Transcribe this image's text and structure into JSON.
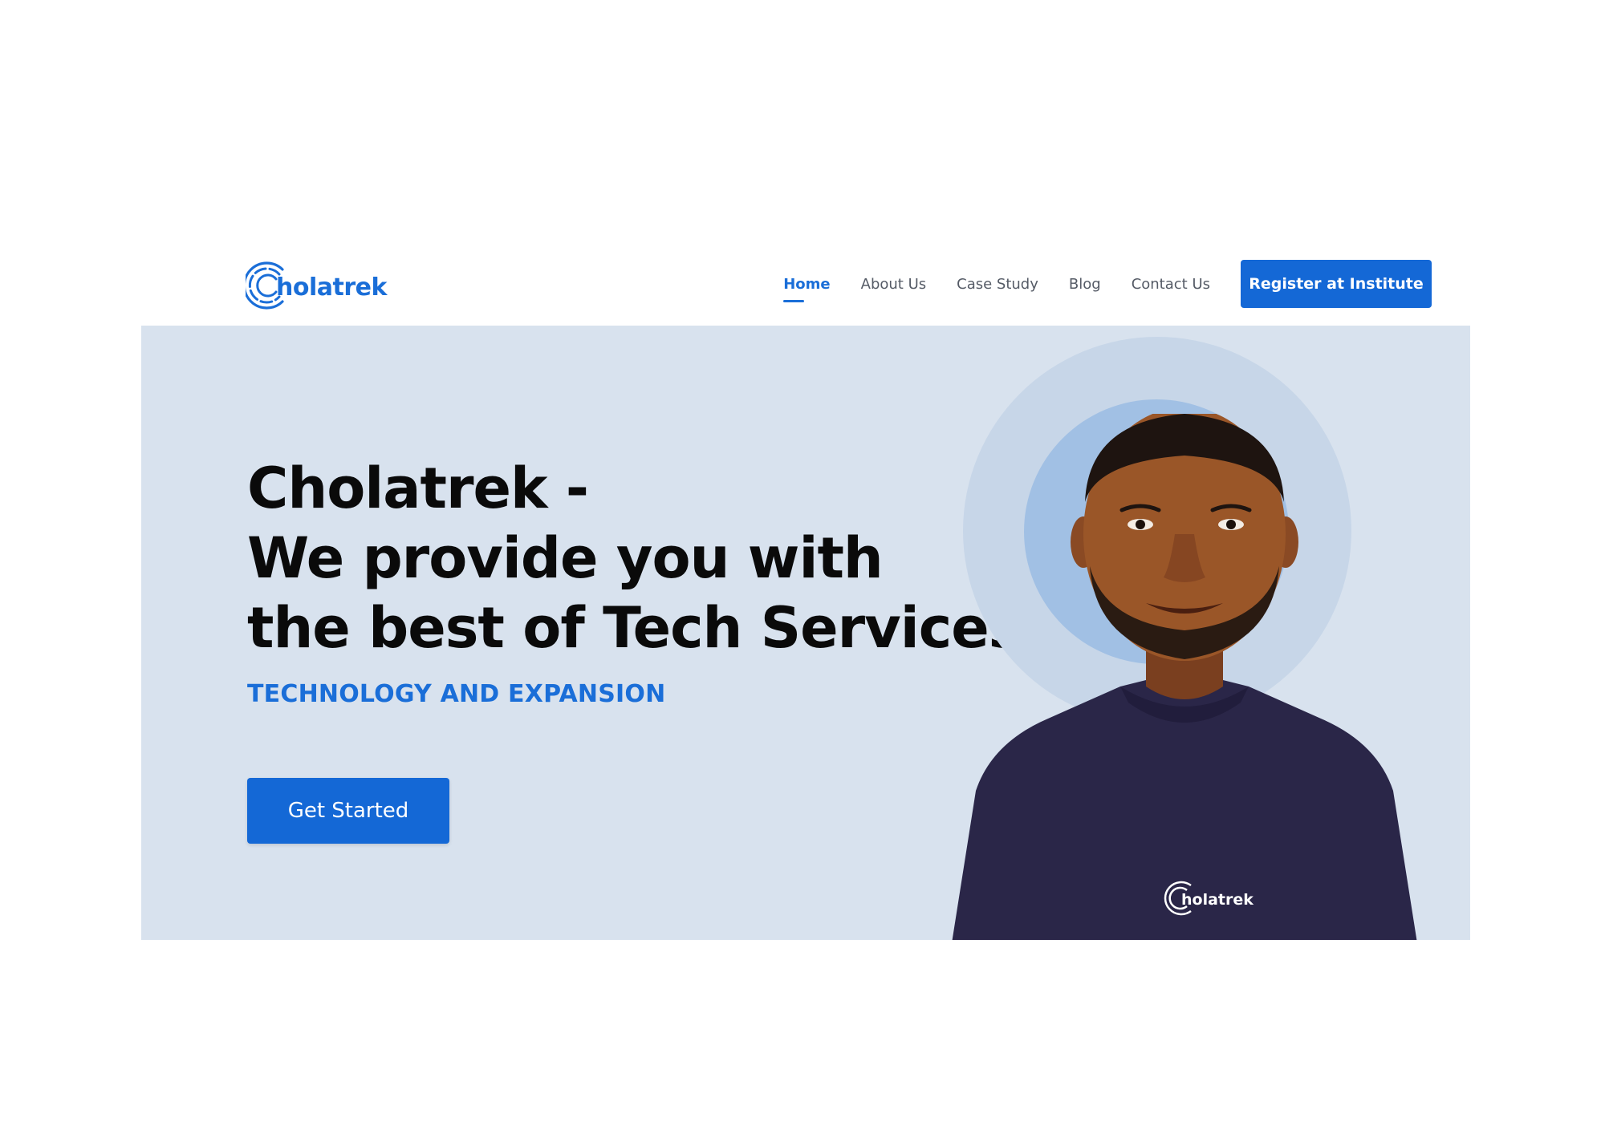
{
  "brand": {
    "name": "holatrek",
    "accent_color": "#1a6ed8",
    "logo_icon": "concentric-c-logo-icon"
  },
  "nav": {
    "items": [
      {
        "label": "Home",
        "active": true
      },
      {
        "label": "About Us",
        "active": false
      },
      {
        "label": "Case Study",
        "active": false
      },
      {
        "label": "Blog",
        "active": false
      },
      {
        "label": "Contact Us",
        "active": false
      }
    ],
    "register_label": "Register at Institute"
  },
  "hero": {
    "headline": [
      "Cholatrek -",
      "We provide you with",
      "the best of Tech Services"
    ],
    "tagline": "TECHNOLOGY AND EXPANSION",
    "cta_label": "Get Started",
    "background_color": "#d8e2ee",
    "portrait": {
      "subject": "smiling man in navy t-shirt",
      "shirt_logo_text": "holatrek"
    }
  }
}
